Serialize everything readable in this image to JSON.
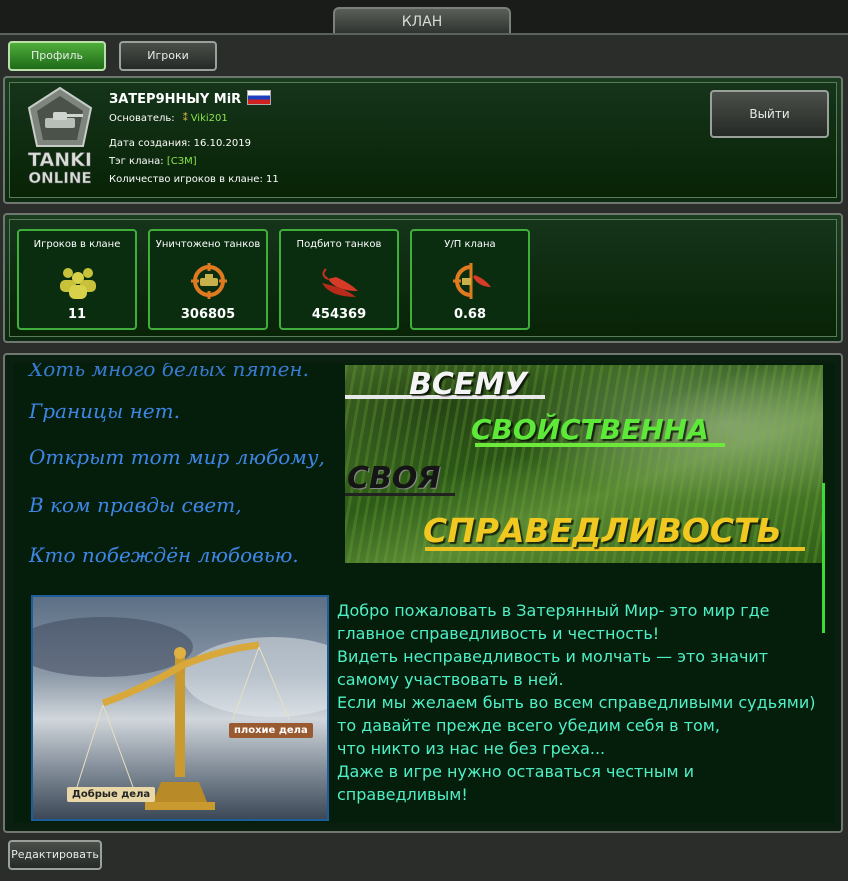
{
  "title": "КЛАН",
  "tabs": {
    "profile": "Профиль",
    "players": "Игроки"
  },
  "clan": {
    "name": "ЗАТЕР9ННЫY MiR",
    "founder_label": "Основатель:",
    "founder": "Viki201",
    "created_label": "Дата создания:",
    "created": "16.10.2019",
    "tag_label": "Тэг клана:",
    "tag": "[СЗМ]",
    "players_label": "Количество игроков в клане:",
    "players": "11",
    "logo_text": [
      "TANKI",
      "ONLINE"
    ]
  },
  "exit_button": "Выйти",
  "stats": [
    {
      "label": "Игроков в клане",
      "value": "11",
      "icon": "players-icon"
    },
    {
      "label": "Уничтожено танков",
      "value": "306805",
      "icon": "crosshair-tank-icon"
    },
    {
      "label": "Подбито танков",
      "value": "454369",
      "icon": "pepper-icon"
    },
    {
      "label": "У/П клана",
      "value": "0.68",
      "icon": "crosshair-pepper-icon"
    }
  ],
  "poem": [
    "Хоть много белых пятен.",
    "Границы нет.",
    "Открыт тот мир любому,",
    "В ком правды свет,",
    "Кто побеждён любовью."
  ],
  "banner": [
    "ВСЕМУ",
    "СВОЙСТВЕННА",
    "СВОЯ",
    "СПРАВЕДЛИВОСТЬ"
  ],
  "scales_labels": {
    "bad": "плохие дела",
    "good": "Добрые дела"
  },
  "welcome": [
    "Добро пожаловать в Затерянный Мир- это мир где",
    "главное справедливость и честность!",
    "Видеть несправедливость и молчать — это значит",
    "самому участвовать в ней.",
    "Если мы желаем быть во всем справедливыми судьями)",
    "то давайте прежде всего убедим себя в том,",
    "что никто из нас не без греха...",
    "Даже в игре нужно оставаться честным и",
    "справедливым!"
  ],
  "edit_button": "Редактировать"
}
